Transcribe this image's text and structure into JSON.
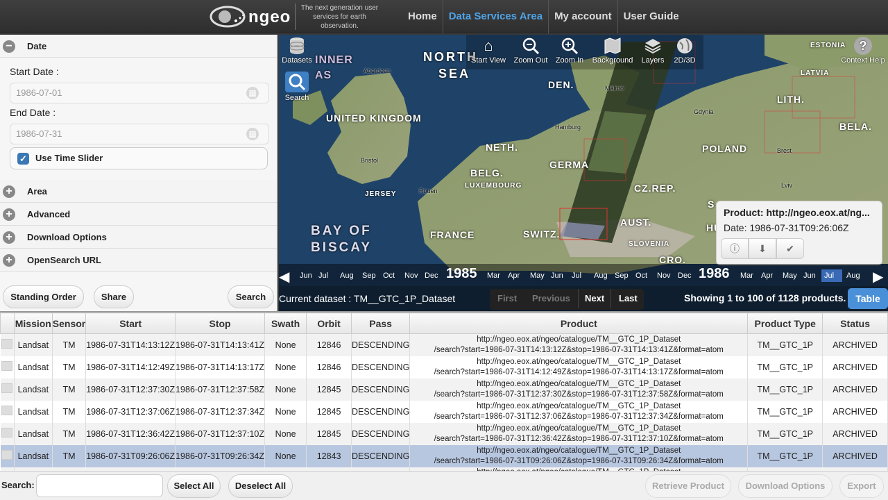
{
  "header": {
    "logo_text": "ngeo",
    "tagline": "The next generation user services for earth observation.",
    "nav": [
      {
        "label": "Home",
        "active": false
      },
      {
        "label": "Data Services Area",
        "active": true
      },
      {
        "label": "My account",
        "active": false
      },
      {
        "label": "User Guide",
        "active": false
      }
    ]
  },
  "left_panel": {
    "date_section": "Date",
    "start_label": "Start Date :",
    "start_value": "1986-07-01",
    "end_label": "End Date :",
    "end_value": "1986-07-31",
    "time_slider_label": "Use Time Slider",
    "sections": [
      "Area",
      "Advanced",
      "Download Options",
      "OpenSearch URL"
    ],
    "buttons": {
      "standing_order": "Standing Order",
      "share": "Share",
      "search": "Search"
    }
  },
  "map": {
    "toolbar": {
      "datasets": "Datasets",
      "search": "Search",
      "start_view": "Start View",
      "zoom_out": "Zoom Out",
      "zoom_in": "Zoom In",
      "background": "Background",
      "layers": "Layers",
      "view_2d3d": "2D/3D",
      "context_help": "Context Help"
    },
    "labels": {
      "north_sea_1": "NORTH",
      "north_sea_2": "SEA",
      "inner": "INNER",
      "as": "AS",
      "aberdeen": "Aberdeen",
      "uk": "UNITED KINGDOM",
      "den": "DEN.",
      "estonia": "ESTONIA",
      "latvia": "LATVIA",
      "lith": "LITH.",
      "gdynia": "Gdynia",
      "hamburg": "Hamburg",
      "bela": "BELA.",
      "poland": "POLAND",
      "brest": "Brest",
      "bristol": "Bristol",
      "neth": "NETH.",
      "germany": "GERMA",
      "belg": "BELG.",
      "luxembourg": "LUXEMBOURG",
      "czrep": "CZ.REP.",
      "jersey": "JERSEY",
      "rouen": "Rouen",
      "lviv": "Lviv",
      "bay1": "BAY OF",
      "bay2": "BISCAY",
      "france": "FRANCE",
      "switz": "SWITZ.",
      "aust": "AUST.",
      "slovenia": "SLOVENIA",
      "cro": "CRO.",
      "s": "S",
      "hu": "HU",
      "malmo": "Malmö"
    },
    "popup": {
      "product": "Product: http://ngeo.eox.at/ng...",
      "date": "Date: 1986-07-31T09:26:06Z"
    },
    "timeline": {
      "months_1985": [
        "Jun",
        "Jul",
        "Aug",
        "Sep",
        "Oct",
        "Nov",
        "Dec"
      ],
      "year_1985": "1985",
      "months_1985b": [
        "Mar",
        "Apr",
        "May",
        "Jun",
        "Jul",
        "Aug",
        "Sep",
        "Oct",
        "Nov",
        "Dec"
      ],
      "year_1986": "1986",
      "months_1986": [
        "Mar",
        "Apr",
        "May",
        "Jun",
        "Jul",
        "Aug"
      ]
    },
    "current_dataset": "Current dataset : TM__GTC_1P_Dataset",
    "pager": {
      "first": "First",
      "previous": "Previous",
      "next": "Next",
      "last": "Last"
    },
    "showing": "Showing 1 to 100 of 1128 products.",
    "table_button": "Table"
  },
  "table": {
    "columns": [
      "Mission",
      "Sensor",
      "Start",
      "Stop",
      "Swath",
      "Orbit",
      "Pass",
      "Product",
      "Product Type",
      "Status"
    ],
    "rows": [
      {
        "mission": "Landsat",
        "sensor": "TM",
        "start": "1986-07-31T14:13:12Z",
        "stop": "1986-07-31T14:13:41Z",
        "swath": "None",
        "orbit": "12846",
        "pass": "DESCENDING",
        "p1": "http://ngeo.eox.at/ngeo/catalogue/TM__GTC_1P_Dataset",
        "p2": "/search?start=1986-07-31T14:13:12Z&stop=1986-07-31T14:13:41Z&format=atom",
        "type": "TM__GTC_1P",
        "status": "ARCHIVED"
      },
      {
        "mission": "Landsat",
        "sensor": "TM",
        "start": "1986-07-31T14:12:49Z",
        "stop": "1986-07-31T14:13:17Z",
        "swath": "None",
        "orbit": "12846",
        "pass": "DESCENDING",
        "p1": "http://ngeo.eox.at/ngeo/catalogue/TM__GTC_1P_Dataset",
        "p2": "/search?start=1986-07-31T14:12:49Z&stop=1986-07-31T14:13:17Z&format=atom",
        "type": "TM__GTC_1P",
        "status": "ARCHIVED"
      },
      {
        "mission": "Landsat",
        "sensor": "TM",
        "start": "1986-07-31T12:37:30Z",
        "stop": "1986-07-31T12:37:58Z",
        "swath": "None",
        "orbit": "12845",
        "pass": "DESCENDING",
        "p1": "http://ngeo.eox.at/ngeo/catalogue/TM__GTC_1P_Dataset",
        "p2": "/search?start=1986-07-31T12:37:30Z&stop=1986-07-31T12:37:58Z&format=atom",
        "type": "TM__GTC_1P",
        "status": "ARCHIVED"
      },
      {
        "mission": "Landsat",
        "sensor": "TM",
        "start": "1986-07-31T12:37:06Z",
        "stop": "1986-07-31T12:37:34Z",
        "swath": "None",
        "orbit": "12845",
        "pass": "DESCENDING",
        "p1": "http://ngeo.eox.at/ngeo/catalogue/TM__GTC_1P_Dataset",
        "p2": "/search?start=1986-07-31T12:37:06Z&stop=1986-07-31T12:37:34Z&format=atom",
        "type": "TM__GTC_1P",
        "status": "ARCHIVED"
      },
      {
        "mission": "Landsat",
        "sensor": "TM",
        "start": "1986-07-31T12:36:42Z",
        "stop": "1986-07-31T12:37:10Z",
        "swath": "None",
        "orbit": "12845",
        "pass": "DESCENDING",
        "p1": "http://ngeo.eox.at/ngeo/catalogue/TM__GTC_1P_Dataset",
        "p2": "/search?start=1986-07-31T12:36:42Z&stop=1986-07-31T12:37:10Z&format=atom",
        "type": "TM__GTC_1P",
        "status": "ARCHIVED"
      },
      {
        "mission": "Landsat",
        "sensor": "TM",
        "start": "1986-07-31T09:26:06Z",
        "stop": "1986-07-31T09:26:34Z",
        "swath": "None",
        "orbit": "12843",
        "pass": "DESCENDING",
        "p1": "http://ngeo.eox.at/ngeo/catalogue/TM__GTC_1P_Dataset",
        "p2": "/search?start=1986-07-31T09:26:06Z&stop=1986-07-31T09:26:34Z&format=atom",
        "type": "TM__GTC_1P",
        "status": "ARCHIVED",
        "selected": true
      }
    ],
    "partial_row": "http://ngeo.eox.at/ngeo/catalogue/TM__GTC_1P_Dataset"
  },
  "bottom": {
    "search_label": "Search:",
    "search_value": "",
    "select_all": "Select All",
    "deselect_all": "Deselect All",
    "retrieve": "Retrieve Product",
    "download_options": "Download Options",
    "export": "Export"
  },
  "colors": {
    "accent": "#4fa3e6",
    "selected_row": "#b8c7e0",
    "table_btn": "#4a90d9"
  }
}
